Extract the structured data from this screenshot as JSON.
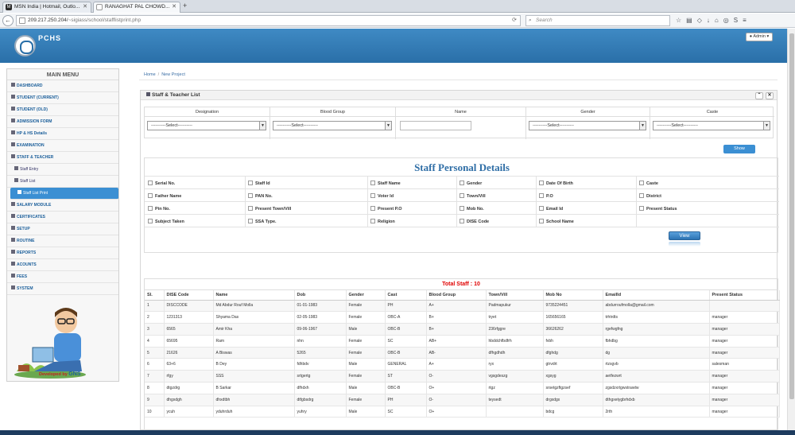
{
  "browser": {
    "tabs": [
      {
        "label": "MSN India | Hotmail, Outlo...",
        "favicon": "msn-icon"
      },
      {
        "label": "RANAGHAT PAL CHOWD...",
        "favicon": "page-icon"
      }
    ],
    "url_host": "209.217.250.204/",
    "url_path": "~sigiass/school/stafflistprint.php",
    "search_placeholder": "Search"
  },
  "app": {
    "brand": "PCHS",
    "admin_label": "Admin"
  },
  "sidebar": {
    "title": "MAIN MENU",
    "items": [
      {
        "label": "DASHBOARD",
        "sub": false,
        "active": false
      },
      {
        "label": "STUDENT (CURRENT)",
        "sub": false,
        "active": false
      },
      {
        "label": "STUDENT (OLD)",
        "sub": false,
        "active": false
      },
      {
        "label": "ADMISSION FORM",
        "sub": false,
        "active": false
      },
      {
        "label": "HP & HS Details",
        "sub": false,
        "active": false
      },
      {
        "label": "EXAMINATION",
        "sub": false,
        "active": false
      },
      {
        "label": "STAFF & TEACHER",
        "sub": false,
        "active": false
      },
      {
        "label": "Staff Entry",
        "sub": true,
        "active": false
      },
      {
        "label": "Staff List",
        "sub": true,
        "active": false
      },
      {
        "label": "Staff List Print",
        "sub": true,
        "active": true
      },
      {
        "label": "SALARY MODULE",
        "sub": false,
        "active": false
      },
      {
        "label": "CERTIFICATES",
        "sub": false,
        "active": false
      },
      {
        "label": "SETUP",
        "sub": false,
        "active": false
      },
      {
        "label": "ROUTINE",
        "sub": false,
        "active": false
      },
      {
        "label": "REPORTS",
        "sub": false,
        "active": false
      },
      {
        "label": "ACOUNTS",
        "sub": false,
        "active": false
      },
      {
        "label": "FEES",
        "sub": false,
        "active": false
      },
      {
        "label": "SYSTEM",
        "sub": false,
        "active": false
      }
    ],
    "developed_by": "Developed by",
    "developer_logo": "GNS"
  },
  "breadcrumb": {
    "home": "Home",
    "current": "New Project"
  },
  "panel": {
    "title": "Staff & Teacher List",
    "filters": [
      {
        "label": "Designation",
        "type": "select",
        "value": "----------Select----------"
      },
      {
        "label": "Blood Group",
        "type": "select",
        "value": "----------Select----------"
      },
      {
        "label": "Name",
        "type": "input",
        "value": ""
      },
      {
        "label": "Gender",
        "type": "select",
        "value": "----------Select----------"
      },
      {
        "label": "Caste",
        "type": "select",
        "value": "----------Select----------"
      }
    ],
    "show_label": "Show",
    "details_title": "Staff Personal Details",
    "fields": [
      [
        "Serial No.",
        "Staff Id",
        "Staff Name",
        "Gender",
        "Date Of Birth",
        "Caste"
      ],
      [
        "Father Name",
        "PAN No.",
        "Voter Id",
        "Town/Vill",
        "P.O",
        "District"
      ],
      [
        "Pin No.",
        "Present Town/Vill",
        "Present P.O",
        "Mob No.",
        "Email Id",
        "Present Status"
      ],
      [
        "Subject Taken",
        "SSA Type.",
        "Religion",
        "DISE Code",
        "School Name"
      ]
    ],
    "view_label": "View",
    "total_label": "Total Staff : 10",
    "columns": [
      "Sl.",
      "DISE Code",
      "Name",
      "Dob",
      "Gender",
      "Cast",
      "Blood Group",
      "Town/Vill",
      "Mob No",
      "EmailId",
      "Present Status"
    ],
    "rows": [
      [
        "1",
        "DISCCODE",
        "Md Abdur Rouf Molla",
        "01-01-1983",
        "Female",
        "PH",
        "A+",
        "Padmapukur",
        "9735224451",
        "abdurroufmolla@gmail.com",
        ""
      ],
      [
        "2",
        "1231313",
        "Shyama Das",
        "02-05-1983",
        "Female",
        "OBC-A",
        "B+",
        "tryet",
        "165656165",
        "trhtrdts",
        "manager"
      ],
      [
        "3",
        "6565",
        "Amir Kha",
        "09-06-1967",
        "Male",
        "OBC-B",
        "B+",
        "236rfggre",
        "36626262",
        "rgefwgfng",
        "manager"
      ],
      [
        "4",
        "65695",
        "Ram",
        "nhn",
        "Female",
        "SC",
        "AB+",
        "hbddchfbdfrh",
        "fvbh",
        "fbhdbg",
        "manager"
      ],
      [
        "5",
        "21626",
        "A Biswas",
        "5265",
        "Female",
        "OBC-B",
        "AB-",
        "dfhgdhdh",
        "dfghdg",
        "dg",
        "manager"
      ],
      [
        "6",
        "63+6",
        "B Dey",
        "fdhbdv",
        "Male",
        "GENERAL",
        "A+",
        "ryx",
        "gtrvdrt",
        "rtzsgvb",
        "salesman"
      ],
      [
        "7",
        "rfgy",
        "SSS",
        "srtgertg",
        "Female",
        "ST",
        "O-",
        "vgsgdeszg",
        "xgsyg",
        "aetfezwrt",
        "manager"
      ],
      [
        "8",
        "dtgzdrg",
        "B Sarkar",
        "dfhdxh",
        "Male",
        "OBC-B",
        "O+",
        "rtgz",
        "srsetgzftgzsef",
        "zgsdzxrtgwstrawtw",
        "manager"
      ],
      [
        "9",
        "dhgxdgh",
        "dhxdtbh",
        "dtfgbsdrg",
        "Female",
        "PH",
        "O-",
        "teysedt",
        "drgxdgx",
        "dthgxetygbrhdxb",
        "manager"
      ],
      [
        "10",
        "ycuh",
        "yduhrduh",
        "yuhry",
        "Male",
        "SC",
        "O+",
        "",
        "bdcg",
        "2rth",
        "manager"
      ]
    ]
  }
}
